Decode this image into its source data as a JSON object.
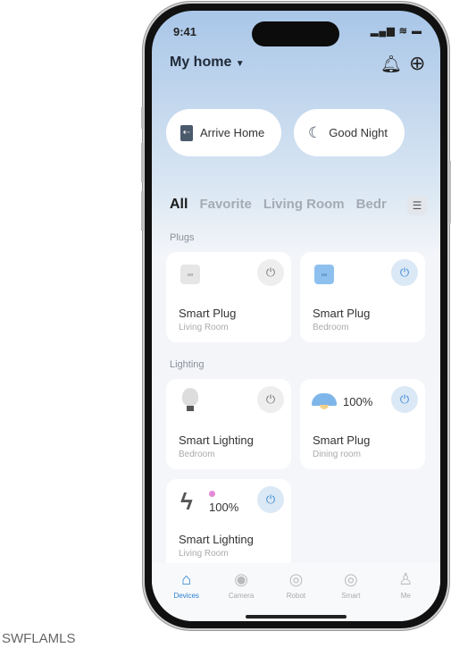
{
  "status": {
    "time": "9:41",
    "indicators": "▂▄▆ ≋ ▬"
  },
  "header": {
    "title": "My home",
    "dropdown_icon": "caret-down",
    "bell_icon": "bell",
    "add_icon": "plus-circle"
  },
  "scenes": [
    {
      "label": "Arrive Home",
      "icon": "door-enter"
    },
    {
      "label": "Good Night",
      "icon": "moon"
    }
  ],
  "tabs": [
    "All",
    "Favorite",
    "Living Room",
    "Bedr"
  ],
  "sections": {
    "plugs": "Plugs",
    "lighting": "Lighting"
  },
  "devices": [
    {
      "name": "Smart Plug",
      "room": "Living Room",
      "on": false,
      "icon": "plug"
    },
    {
      "name": "Smart Plug",
      "room": "Bedroom",
      "on": true,
      "icon": "plug"
    },
    {
      "name": "Smart Lighting",
      "room": "Bedroom",
      "on": false,
      "icon": "bulb"
    },
    {
      "name": "Smart Plug",
      "room": "Dining room",
      "on": true,
      "icon": "pendant-lamp",
      "level": "100%"
    },
    {
      "name": "Smart Lighting",
      "room": "Living Room",
      "on": true,
      "icon": "light-strip",
      "level": "100%"
    }
  ],
  "tabbar": [
    {
      "label": "Devices",
      "active": true
    },
    {
      "label": "Camera"
    },
    {
      "label": "Robot"
    },
    {
      "label": "Smart"
    },
    {
      "label": "Me"
    }
  ],
  "watermark": "SWFLAMLS",
  "colors": {
    "accent": "#2a7fd0",
    "power_on_bg": "#dbe8f5"
  }
}
